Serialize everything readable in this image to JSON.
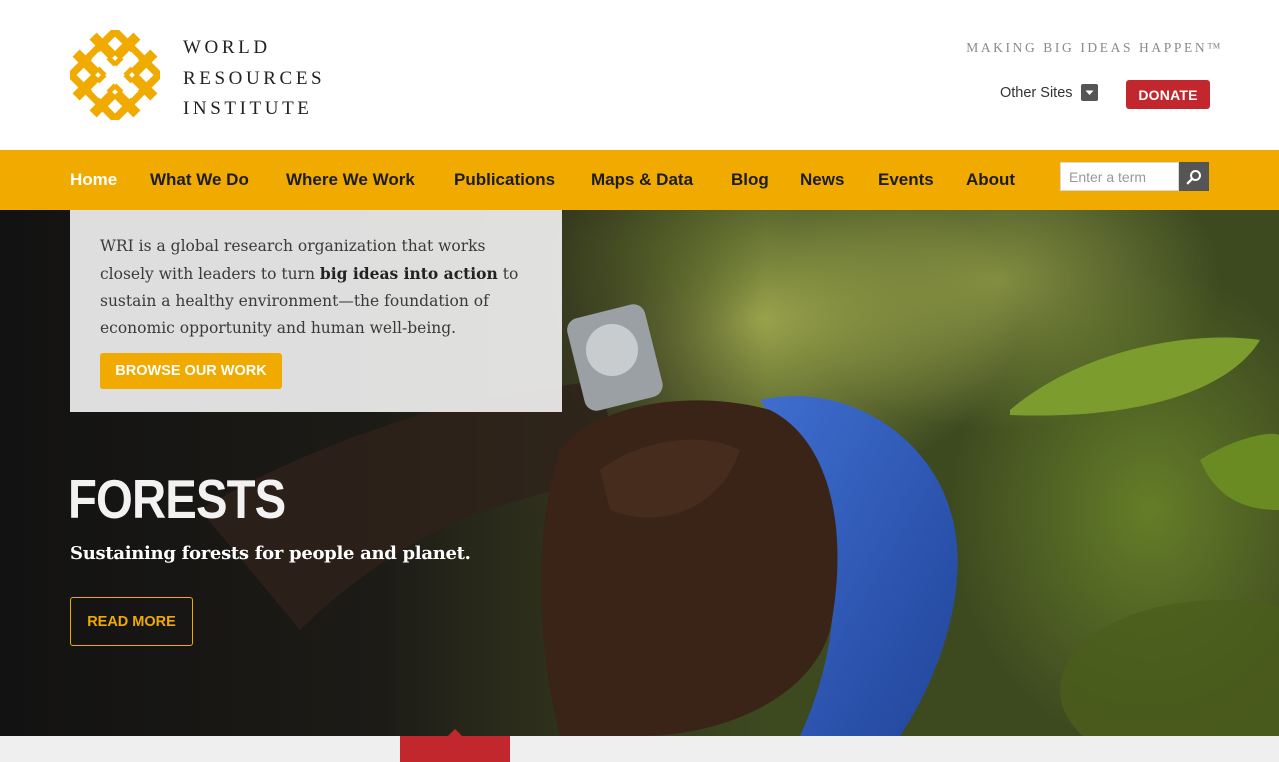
{
  "header": {
    "logo": {
      "lines": [
        "WORLD",
        "RESOURCES",
        "INSTITUTE"
      ],
      "icon": "wri-knot-logo-icon",
      "color": "#f0aa00"
    },
    "tagline": "MAKING BIG IDEAS HAPPEN™",
    "other_sites": {
      "label": "Other Sites",
      "icon": "chevron-down-icon"
    },
    "donate_label": "DONATE"
  },
  "nav": {
    "items": [
      {
        "label": "Home",
        "active": true
      },
      {
        "label": "What We Do"
      },
      {
        "label": "Where We Work"
      },
      {
        "label": "Publications"
      },
      {
        "label": "Maps & Data"
      },
      {
        "label": "Blog"
      },
      {
        "label": "News"
      },
      {
        "label": "Events"
      },
      {
        "label": "About"
      }
    ],
    "search": {
      "placeholder": "Enter a term",
      "value": "",
      "icon": "search-icon"
    }
  },
  "intro": {
    "text_before": "WRI is a global research organization that works closely with leaders to turn ",
    "text_bold": "big ideas into action",
    "text_after": " to sustain a healthy environment—the foundation of economic opportunity and human well-being.",
    "button_label": "BROWSE OUR WORK"
  },
  "hero": {
    "title": "FORESTS",
    "subtitle": "Sustaining forests for people and planet.",
    "button_label": "READ MORE"
  },
  "colors": {
    "brand_yellow": "#f0aa00",
    "donate_red": "#c1272d",
    "nav_text": "#1d1d1d"
  }
}
